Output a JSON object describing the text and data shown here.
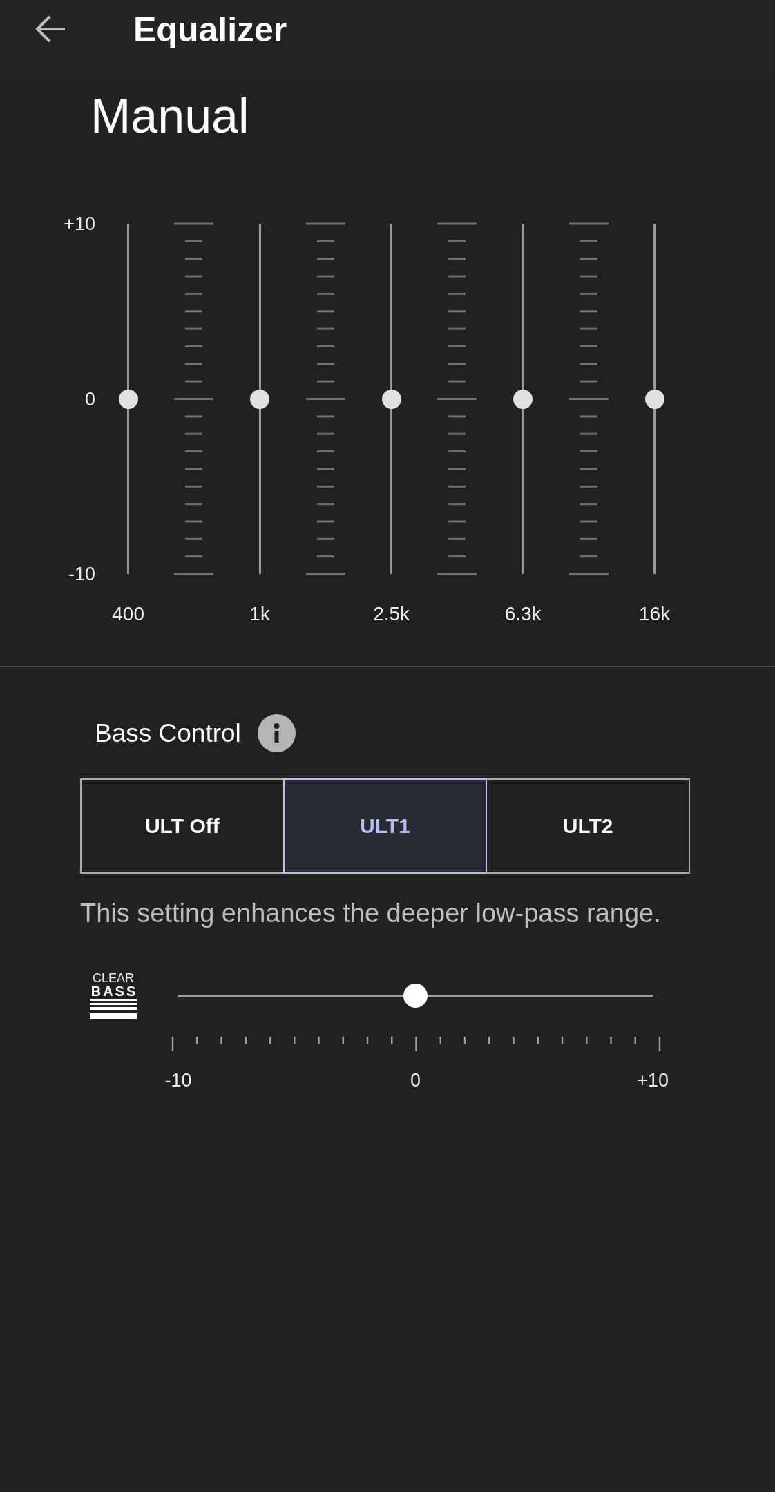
{
  "header": {
    "title": "Equalizer"
  },
  "preset": {
    "name": "Manual"
  },
  "equalizer": {
    "scale_labels": [
      "+10",
      "0",
      "-10"
    ],
    "bands": [
      {
        "frequency": "400",
        "level": 0.5
      },
      {
        "frequency": "1k",
        "level": 0.5
      },
      {
        "frequency": "2.5k",
        "level": 0.5
      },
      {
        "frequency": "6.3k",
        "level": 0.5
      },
      {
        "frequency": "16k",
        "level": 0.5
      }
    ]
  },
  "bass_control": {
    "title": "Bass Control",
    "options": [
      {
        "label": "ULT Off",
        "selected": false
      },
      {
        "label": "ULT1",
        "selected": true
      },
      {
        "label": "ULT2",
        "selected": false
      }
    ],
    "description": "This setting enhances the deeper low-pass range."
  },
  "clear_bass": {
    "logo_text": [
      "CLEAR",
      "BASS"
    ],
    "level": 0.5,
    "scale_labels": [
      "-10",
      "0",
      "+10"
    ]
  }
}
